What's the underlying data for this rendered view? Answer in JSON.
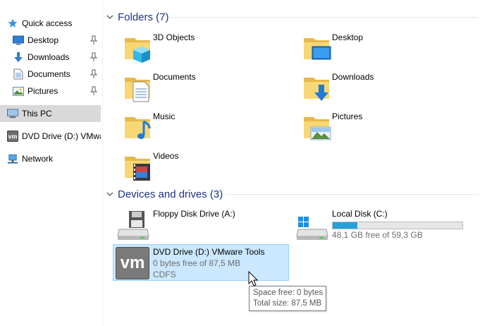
{
  "nav": {
    "quick_access": "Quick access",
    "items": [
      {
        "label": "Desktop",
        "icon": "desktop-icon",
        "pinned": true
      },
      {
        "label": "Downloads",
        "icon": "downloads-icon",
        "pinned": true
      },
      {
        "label": "Documents",
        "icon": "documents-icon",
        "pinned": true
      },
      {
        "label": "Pictures",
        "icon": "pictures-icon",
        "pinned": true
      }
    ],
    "this_pc": "This PC",
    "dvd_drive": "DVD Drive (D:) VMwa",
    "network": "Network"
  },
  "folders_section": {
    "title": "Folders (7)"
  },
  "folders": [
    {
      "label": "3D Objects",
      "icon": "3d-objects-icon"
    },
    {
      "label": "Desktop",
      "icon": "desktop-folder-icon"
    },
    {
      "label": "Documents",
      "icon": "documents-folder-icon"
    },
    {
      "label": "Downloads",
      "icon": "downloads-folder-icon"
    },
    {
      "label": "Music",
      "icon": "music-folder-icon"
    },
    {
      "label": "Pictures",
      "icon": "pictures-folder-icon"
    },
    {
      "label": "Videos",
      "icon": "videos-folder-icon"
    }
  ],
  "drives_section": {
    "title": "Devices and drives (3)"
  },
  "drives": {
    "floppy": {
      "name": "Floppy Disk Drive (A:)",
      "icon": "floppy-drive-icon"
    },
    "local": {
      "name": "Local Disk (C:)",
      "free_text": "48,1 GB free of 59,3 GB",
      "used_fraction": 0.19,
      "icon": "local-disk-icon"
    },
    "dvd": {
      "name": "DVD Drive (D:) VMware Tools",
      "free_text": "0 bytes free of 87,5 MB",
      "fs": "CDFS",
      "icon": "vmware-dvd-icon"
    }
  },
  "tooltip": {
    "line1": "Space free: 0 bytes",
    "line2": "Total size: 87,5 MB"
  },
  "colors": {
    "accent": "#26a0da",
    "group_title": "#1e3287",
    "selection": "#cce8ff"
  }
}
